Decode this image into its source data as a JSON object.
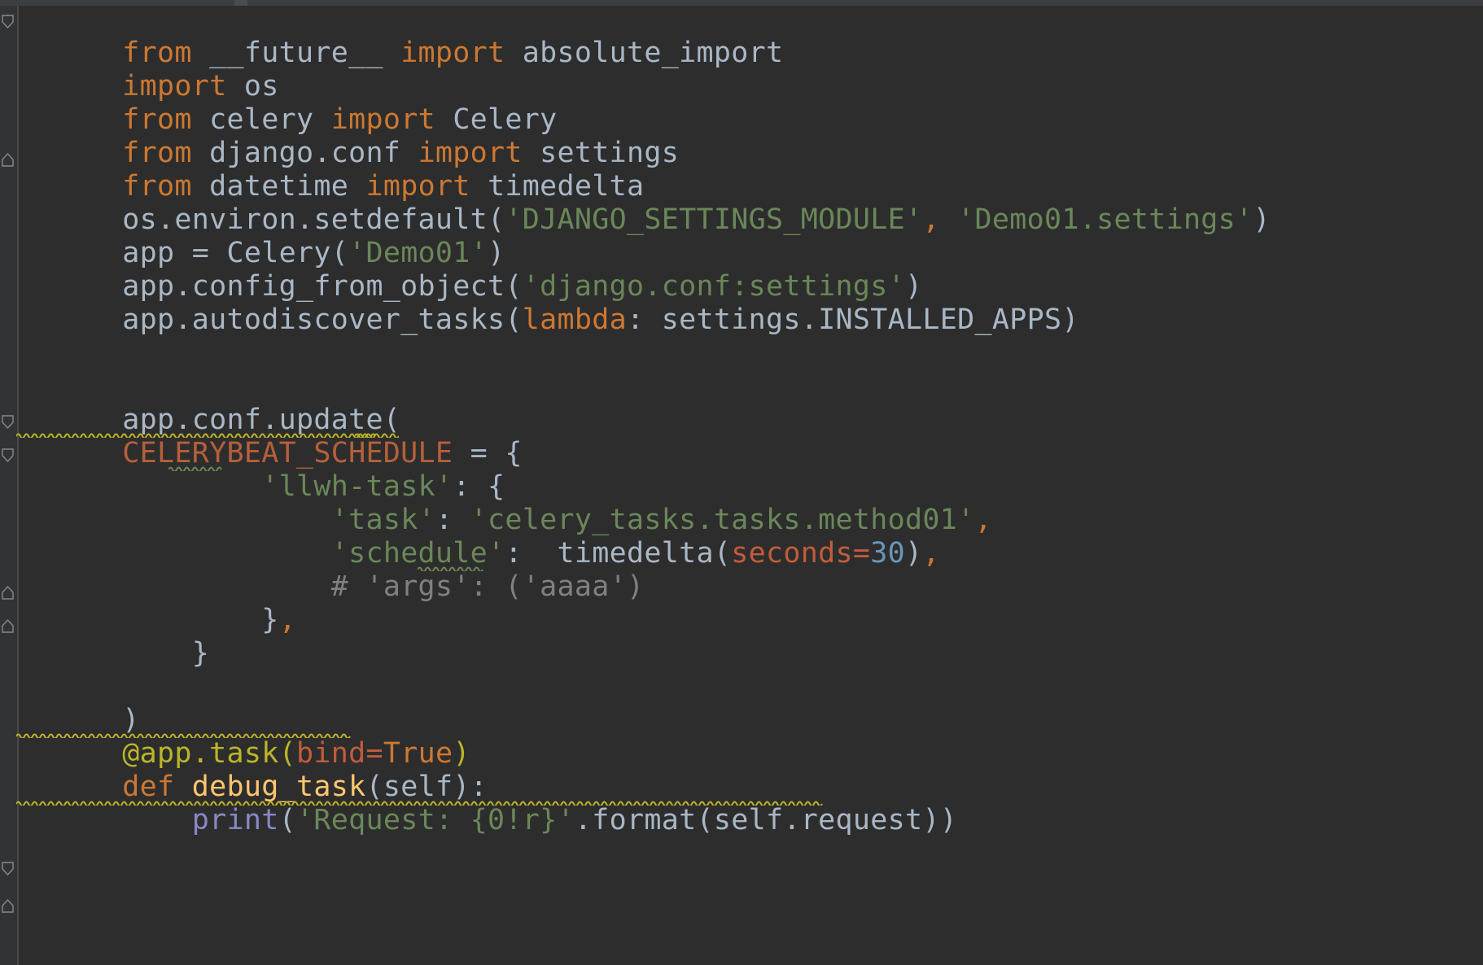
{
  "app": {
    "kind": "code-editor",
    "theme": "darcula",
    "language": "Python",
    "background": "#2d2d2d",
    "gutter_background": "#313335",
    "default_text_color": "#a9b7c6"
  },
  "palette": {
    "keyword": "#cc7832",
    "string": "#6a8759",
    "number": "#6897bb",
    "comment": "#808080",
    "global_constant": "#b5603a",
    "keyword_argument": "#c25c3c",
    "decorator": "#bbb529",
    "function_definition": "#ffc66d",
    "builtin_function": "#8888c6",
    "warning_underline": "#bbb529",
    "typo_underline": "#6a8759"
  },
  "code": {
    "lines": [
      {
        "n": 1,
        "text": "from __future__ import absolute_import"
      },
      {
        "n": 2,
        "text": "import os"
      },
      {
        "n": 3,
        "text": "from celery import Celery"
      },
      {
        "n": 4,
        "text": "from django.conf import settings"
      },
      {
        "n": 5,
        "text": "from datetime import timedelta"
      },
      {
        "n": 6,
        "text": "os.environ.setdefault('DJANGO_SETTINGS_MODULE', 'Demo01.settings')"
      },
      {
        "n": 7,
        "text": "app = Celery('Demo01')"
      },
      {
        "n": 8,
        "text": "app.config_from_object('django.conf:settings')"
      },
      {
        "n": 9,
        "text": "app.autodiscover_tasks(lambda: settings.INSTALLED_APPS)"
      },
      {
        "n": 10,
        "text": ""
      },
      {
        "n": 11,
        "text": ""
      },
      {
        "n": 12,
        "text": "app.conf.update("
      },
      {
        "n": 13,
        "text": "CELERYBEAT_SCHEDULE = {"
      },
      {
        "n": 14,
        "text": "        'llwh-task': {"
      },
      {
        "n": 15,
        "text": "            'task': 'celery_tasks.tasks.method01',"
      },
      {
        "n": 16,
        "text": "            'schedule':  timedelta(seconds=30),"
      },
      {
        "n": 17,
        "text": "            # 'args': ('aaaa')"
      },
      {
        "n": 18,
        "text": "        },"
      },
      {
        "n": 19,
        "text": "    }"
      },
      {
        "n": 20,
        "text": ""
      },
      {
        "n": 21,
        "text": ")"
      },
      {
        "n": 22,
        "text": "@app.task(bind=True)"
      },
      {
        "n": 23,
        "text": "def debug_task(self):"
      },
      {
        "n": 24,
        "text": "    print('Request: {0!r}'.format(self.request))"
      }
    ],
    "annotations": [
      {
        "kind": "warning-squiggle",
        "on_line": 13,
        "over_text": "CELERYBEAT_SCHEDULE = "
      },
      {
        "kind": "typo-squiggle",
        "on_line": 14,
        "over_text": "llwh"
      },
      {
        "kind": "typo-squiggle",
        "on_line": 17,
        "over_text": "aaaa"
      },
      {
        "kind": "warning-squiggle",
        "on_line": 22,
        "over_text": "@app.task(bind=True)"
      },
      {
        "kind": "warning-squiggle",
        "on_line": 24,
        "over_text": "    print('Request: {0!r}'.format(self.request))"
      }
    ],
    "fold_markers": [
      {
        "on_line": 1,
        "state": "expanded-start"
      },
      {
        "on_line": 5,
        "state": "expanded-end"
      },
      {
        "on_line": 13,
        "state": "expanded-start"
      },
      {
        "on_line": 14,
        "state": "expanded-start"
      },
      {
        "on_line": 18,
        "state": "expanded-end"
      },
      {
        "on_line": 19,
        "state": "expanded-end"
      },
      {
        "on_line": 23,
        "state": "expanded-start"
      },
      {
        "on_line": 24,
        "state": "expanded-end"
      }
    ]
  }
}
